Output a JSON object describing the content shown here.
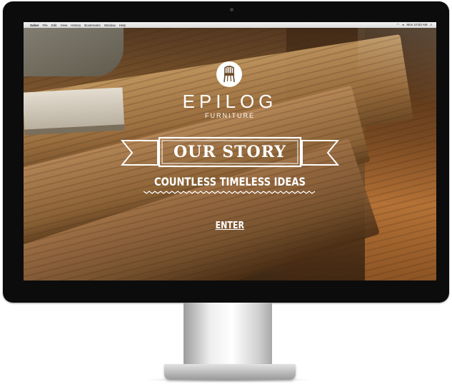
{
  "menubar": {
    "apple": "",
    "items": [
      "Safari",
      "File",
      "Edit",
      "View",
      "History",
      "Bookmarks",
      "Window",
      "Help"
    ],
    "clock": "Mon 10:53 AM"
  },
  "site": {
    "brand": "EPILOG",
    "subtitle": "FURNITURE",
    "banner_title": "OUR STORY",
    "tagline": "COUNTLESS TIMELESS IDEAS",
    "enter_label": "ENTER"
  },
  "icons": {
    "logo": "chair-icon",
    "wifi": "wifi-icon",
    "volume": "volume-icon",
    "search": "search-icon"
  },
  "colors": {
    "text": "#ffffff",
    "bezel": "#0c0c0c",
    "wood": "#8b6236"
  }
}
